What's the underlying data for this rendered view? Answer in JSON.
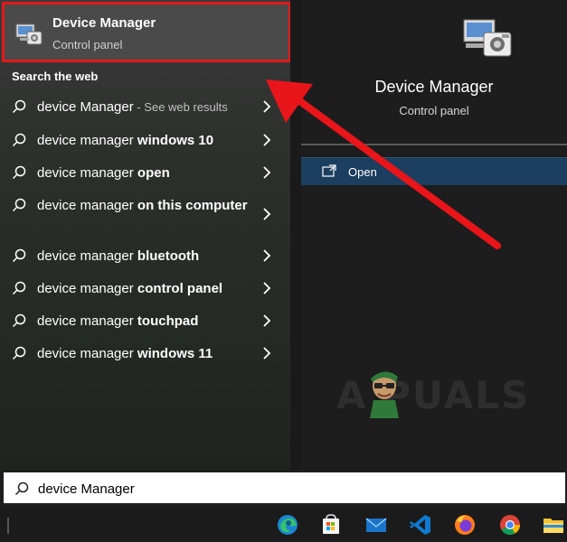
{
  "best_match": {
    "title": "Device Manager",
    "subtitle": "Control panel",
    "icon": "device-manager-icon"
  },
  "section_label": "Search the web",
  "results": [
    {
      "prefix": "device Manager",
      "bold": "",
      "suffix": " - See web results"
    },
    {
      "prefix": "device manager ",
      "bold": "windows 10",
      "suffix": ""
    },
    {
      "prefix": "device manager ",
      "bold": "open",
      "suffix": ""
    },
    {
      "prefix": "device manager ",
      "bold": "on this computer",
      "suffix": ""
    },
    {
      "prefix": "device manager ",
      "bold": "bluetooth",
      "suffix": ""
    },
    {
      "prefix": "device manager ",
      "bold": "control panel",
      "suffix": ""
    },
    {
      "prefix": "device manager ",
      "bold": "touchpad",
      "suffix": ""
    },
    {
      "prefix": "device manager ",
      "bold": "windows 11",
      "suffix": ""
    }
  ],
  "preview": {
    "title": "Device Manager",
    "subtitle": "Control panel",
    "action_label": "Open"
  },
  "watermark": "A PUALS",
  "search": {
    "value": "device Manager"
  },
  "taskbar": {
    "apps": [
      "edge-icon",
      "store-icon",
      "mail-icon",
      "vscode-icon",
      "firefox-icon",
      "chrome-icon",
      "file-explorer-icon"
    ]
  },
  "colors": {
    "highlight_border": "#e0191c",
    "open_row_bg": "#1c3e5f",
    "arrow": "#e8151a"
  }
}
